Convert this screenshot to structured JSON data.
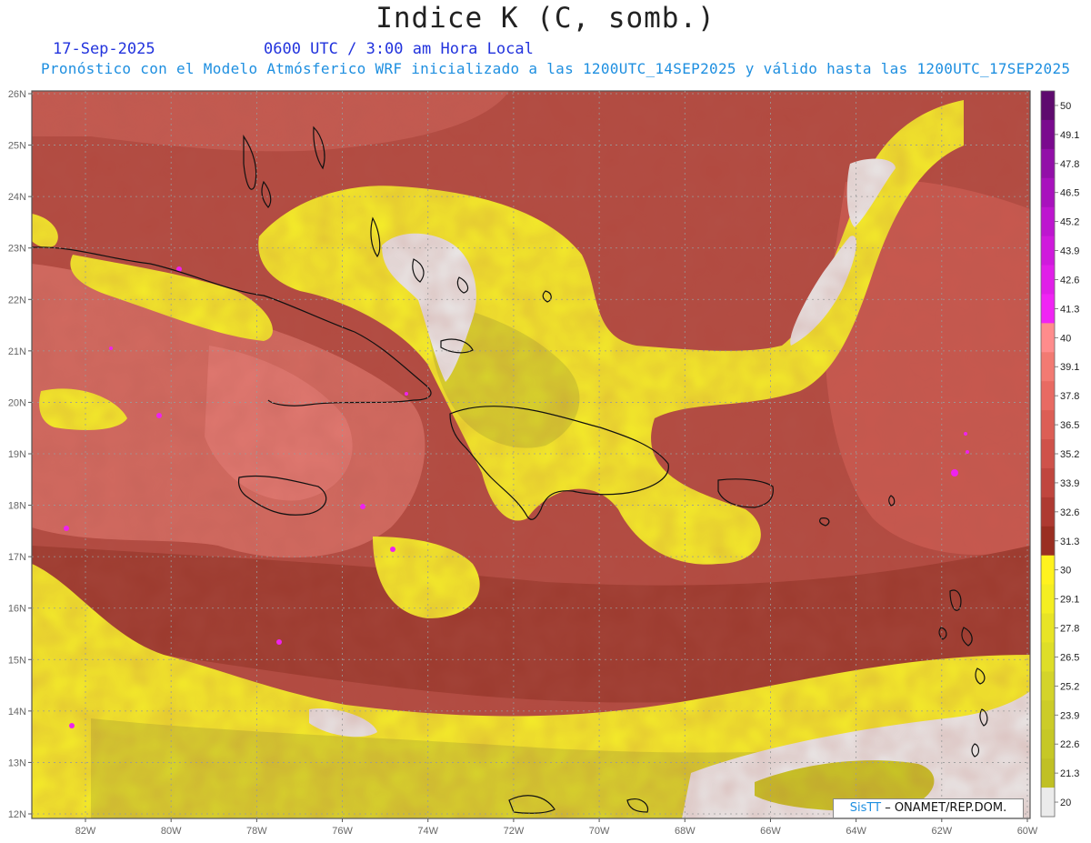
{
  "header": {
    "title": "Indice K (C, somb.)",
    "date": "17-Sep-2025",
    "time": "0600 UTC / 3:00 am Hora Local",
    "subtitle": "Pronóstico con el Modelo Atmósferico WRF inicializado a las 1200UTC_14SEP2025 y válido hasta las  1200UTC_17SEP2025"
  },
  "map": {
    "lat_labels": [
      "26N",
      "25N",
      "24N",
      "23N",
      "22N",
      "21N",
      "20N",
      "19N",
      "18N",
      "17N",
      "16N",
      "15N",
      "14N",
      "13N",
      "12N"
    ],
    "lon_labels": [
      "82W",
      "80W",
      "78W",
      "76W",
      "74W",
      "72W",
      "70W",
      "68W",
      "66W",
      "64W",
      "62W",
      "60W"
    ],
    "grid": "dotted"
  },
  "legend": {
    "levels": [
      "50",
      "49.1",
      "47.8",
      "46.5",
      "45.2",
      "43.9",
      "42.6",
      "41.3",
      "40",
      "39.1",
      "37.8",
      "36.5",
      "35.2",
      "33.9",
      "32.6",
      "31.3",
      "30",
      "29.1",
      "27.8",
      "26.5",
      "25.2",
      "23.9",
      "22.6",
      "21.3",
      "20"
    ],
    "colors": [
      "#5e0a6e",
      "#7a0a8e",
      "#920fa8",
      "#a812bd",
      "#bd16cf",
      "#cf1adc",
      "#e01fe8",
      "#f024f4",
      "#ff8c8c",
      "#f27a72",
      "#e86a62",
      "#dc5e55",
      "#cf524a",
      "#c0463e",
      "#ae3a32",
      "#9a2e22",
      "#fff21e",
      "#f4ee22",
      "#e8e426",
      "#dede28",
      "#d4d42a",
      "#cccc28",
      "#c6c826",
      "#c0c024",
      "#ebebeb"
    ]
  },
  "credit": {
    "sis": "SisTT",
    "org": " – ONAMET/REP.DOM."
  }
}
